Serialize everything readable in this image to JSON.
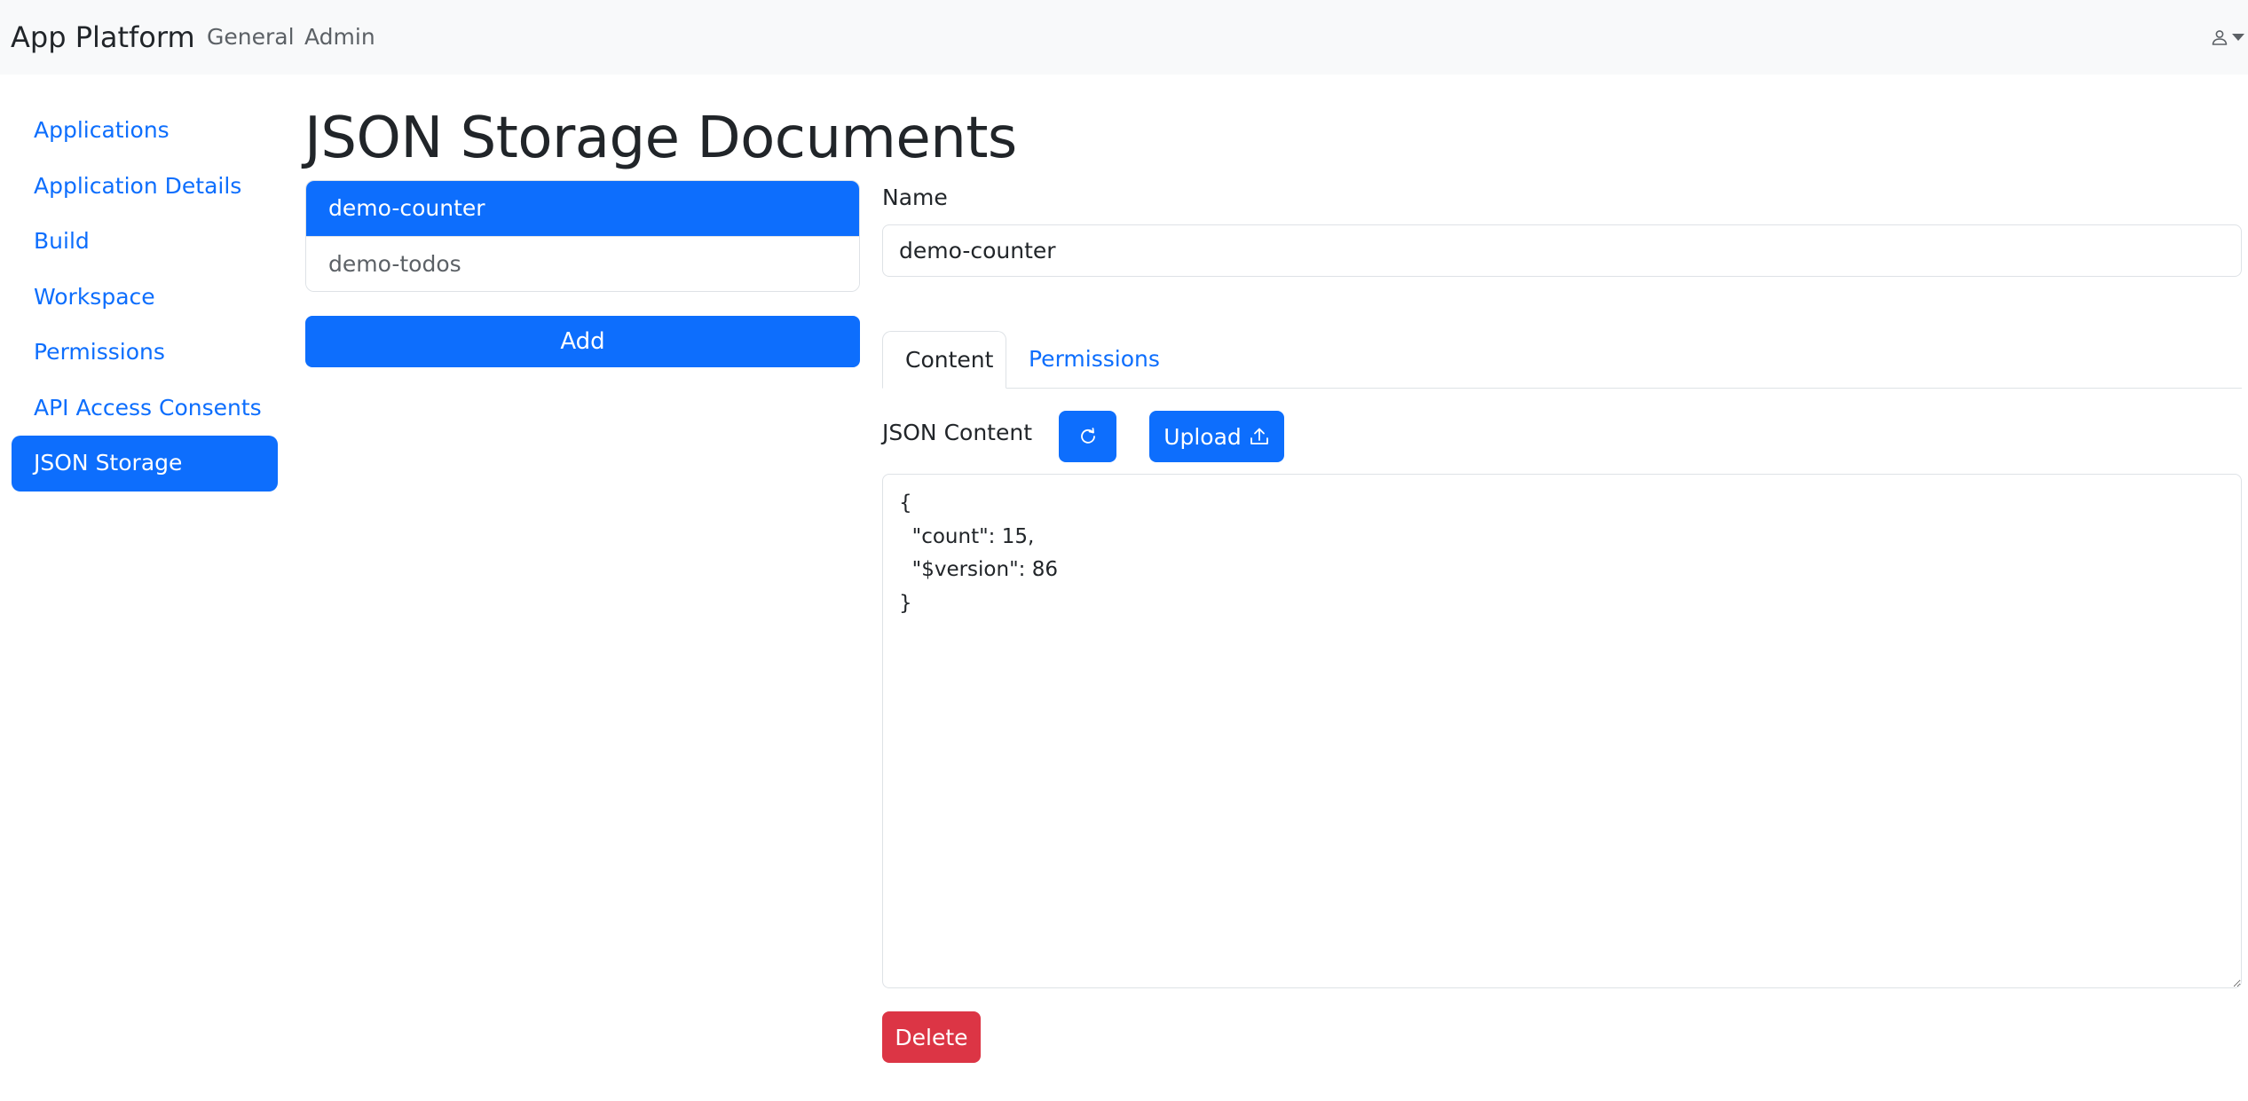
{
  "navbar": {
    "brand": "App Platform",
    "links": [
      "General",
      "Admin"
    ],
    "user_icon": "person-icon"
  },
  "sidebar": {
    "items": [
      {
        "label": "Applications",
        "active": false
      },
      {
        "label": "Application Details",
        "active": false
      },
      {
        "label": "Build",
        "active": false
      },
      {
        "label": "Workspace",
        "active": false
      },
      {
        "label": "Permissions",
        "active": false
      },
      {
        "label": "API Access Consents",
        "active": false
      },
      {
        "label": "JSON Storage",
        "active": true
      }
    ]
  },
  "main": {
    "title": "JSON Storage Documents",
    "documents": [
      {
        "name": "demo-counter",
        "selected": true
      },
      {
        "name": "demo-todos",
        "selected": false
      }
    ],
    "add_label": "Add"
  },
  "editor": {
    "name_label": "Name",
    "name_value": "demo-counter",
    "tabs": [
      {
        "label": "Content",
        "active": true
      },
      {
        "label": "Permissions",
        "active": false
      }
    ],
    "json_label": "JSON Content",
    "refresh_icon": "refresh-icon",
    "upload_label": "Upload",
    "upload_icon": "upload-icon",
    "json_content": "{\n  \"count\": 15,\n  \"$version\": 86\n}",
    "delete_label": "Delete"
  },
  "colors": {
    "primary": "#0d6efd",
    "danger": "#dc3545",
    "navbar_bg": "#f8f9fa",
    "border": "#dee2e6"
  }
}
